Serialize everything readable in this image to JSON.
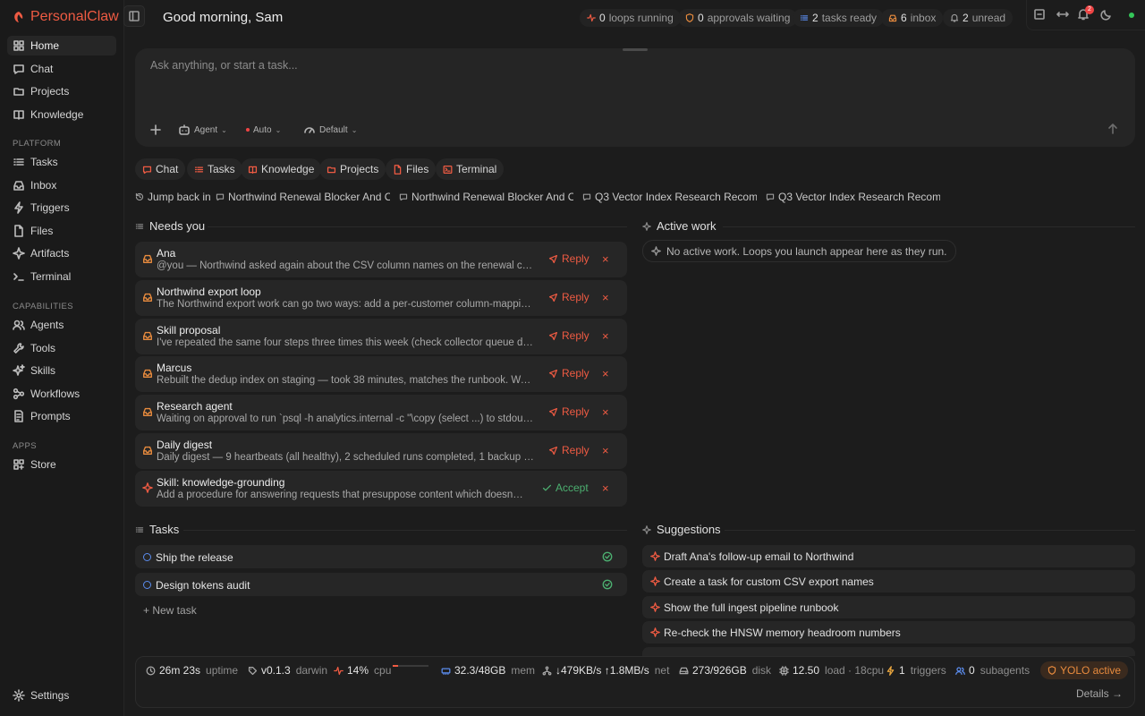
{
  "brand": {
    "name": "PersonalClaw",
    "accent": "#ef5b43"
  },
  "sidebar": {
    "main": [
      {
        "label": "Home",
        "icon": "home-icon",
        "active": true
      },
      {
        "label": "Chat",
        "icon": "chat-icon"
      },
      {
        "label": "Projects",
        "icon": "folder-icon"
      },
      {
        "label": "Knowledge",
        "icon": "book-icon"
      }
    ],
    "platform_label": "PLATFORM",
    "platform": [
      {
        "label": "Tasks",
        "icon": "list-icon"
      },
      {
        "label": "Inbox",
        "icon": "inbox-icon"
      },
      {
        "label": "Triggers",
        "icon": "bolt-icon"
      },
      {
        "label": "Files",
        "icon": "file-icon"
      },
      {
        "label": "Artifacts",
        "icon": "sparkle-icon"
      },
      {
        "label": "Terminal",
        "icon": "terminal-icon"
      }
    ],
    "capabilities_label": "CAPABILITIES",
    "capabilities": [
      {
        "label": "Agents",
        "icon": "users-icon"
      },
      {
        "label": "Tools",
        "icon": "wrench-icon"
      },
      {
        "label": "Skills",
        "icon": "sparkle-icon"
      },
      {
        "label": "Workflows",
        "icon": "workflow-icon"
      },
      {
        "label": "Prompts",
        "icon": "document-icon"
      }
    ],
    "apps_label": "APPS",
    "apps": [
      {
        "label": "Store",
        "icon": "grid-icon"
      }
    ],
    "settings_label": "Settings"
  },
  "header": {
    "greeting": "Good morning, Sam",
    "stats": [
      {
        "value": "0",
        "label": "loops running"
      },
      {
        "value": "0",
        "label": "approvals waiting"
      },
      {
        "value": "2",
        "label": "tasks ready"
      },
      {
        "value": "6",
        "label": "inbox"
      },
      {
        "value": "2",
        "label": "unread"
      }
    ],
    "notification_count": "2"
  },
  "composer": {
    "placeholder": "Ask anything, or start a task...",
    "mode": "Agent",
    "model": "Auto",
    "profile": "Default"
  },
  "quick_links": [
    "Chat",
    "Tasks",
    "Knowledge",
    "Projects",
    "Files",
    "Terminal"
  ],
  "jump_back": {
    "label": "Jump back in",
    "items": [
      "Northwind Renewal Blocker And Ow...",
      "Northwind Renewal Blocker And Ow...",
      "Q3 Vector Index Research Recomm...",
      "Q3 Vector Index Research Recomm..."
    ]
  },
  "needs_you": {
    "title": "Needs you",
    "items": [
      {
        "title": "Ana",
        "text": "@you — Northwind asked again about the CSV column names on the renewal call. D...",
        "action": "Reply"
      },
      {
        "title": "Northwind export loop",
        "text": "The Northwind export work can go two ways: add a per-customer column-mapping ...",
        "action": "Reply"
      },
      {
        "title": "Skill proposal",
        "text": "I've repeated the same four steps three times this week (check collector queue dept...",
        "action": "Reply"
      },
      {
        "title": "Marcus",
        "text": "Rebuilt the dedup index on staging — took 38 minutes, matches the runbook. Want ...",
        "action": "Reply"
      },
      {
        "title": "Research agent",
        "text": "Waiting on approval to run `psql -h analytics.internal -c \"\\copy (select ...) to stdout c...",
        "action": "Reply"
      },
      {
        "title": "Daily digest",
        "text": "Daily digest — 9 heartbeats (all healthy), 2 scheduled runs completed, 1 backup verifi...",
        "action": "Reply"
      },
      {
        "title": "Skill: knowledge-grounding",
        "text": "Add a procedure for answering requests that presuppose content which doesn't e...",
        "action": "Accept"
      }
    ]
  },
  "active_work": {
    "title": "Active work",
    "empty": "No active work. Loops you launch appear here as they run."
  },
  "tasks": {
    "title": "Tasks",
    "items": [
      "Ship the release",
      "Design tokens audit"
    ],
    "new_label": "+ New task"
  },
  "suggestions": {
    "title": "Suggestions",
    "items": [
      "Draft Ana's follow-up email to Northwind",
      "Create a task for custom CSV export names",
      "Show the full ingest pipeline runbook",
      "Re-check the HNSW memory headroom numbers"
    ]
  },
  "footer": {
    "uptime": {
      "value": "26m 23s",
      "label": "uptime"
    },
    "version": {
      "value": "v0.1.3",
      "label": "darwin"
    },
    "cpu": {
      "value": "14%",
      "label": "cpu",
      "fraction": 0.14
    },
    "mem": {
      "value": "32.3/48GB",
      "label": "mem"
    },
    "net": {
      "value": "↓479KB/s ↑1.8MB/s",
      "label": "net"
    },
    "disk": {
      "value": "273/926GB",
      "label": "disk"
    },
    "load": {
      "value": "12.50",
      "label": "load · 18cpu"
    },
    "triggers": {
      "value": "1",
      "label": "triggers"
    },
    "subagents": {
      "value": "0",
      "label": "subagents"
    },
    "yolo": "YOLO active",
    "details": "Details →"
  }
}
